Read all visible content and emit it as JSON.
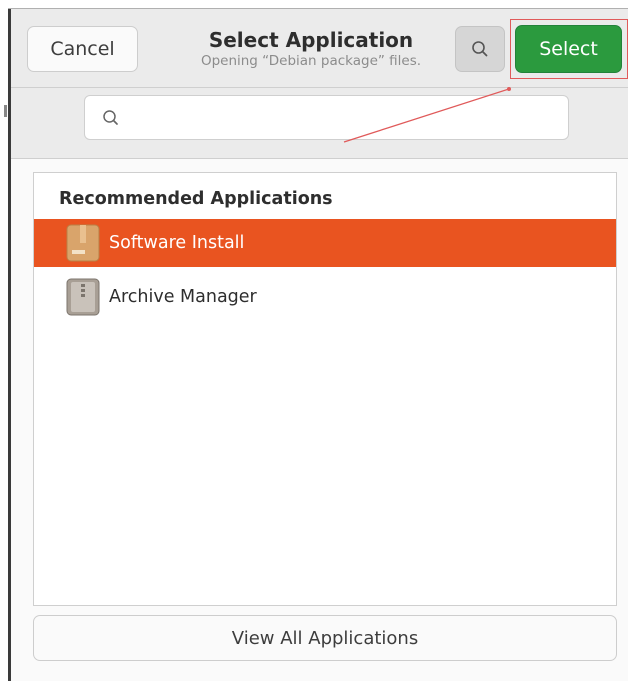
{
  "header": {
    "cancel_label": "Cancel",
    "title": "Select Application",
    "subtitle": "Opening “Debian package” files.",
    "search_icon": "search-icon",
    "select_label": "Select",
    "select_color": "#2b9a3e"
  },
  "search": {
    "placeholder": "",
    "value": "",
    "icon": "search-icon"
  },
  "list": {
    "section_title": "Recommended Applications",
    "items": [
      {
        "label": "Software Install",
        "icon": "software-install-icon",
        "selected": true
      },
      {
        "label": "Archive Manager",
        "icon": "archive-manager-icon",
        "selected": false
      }
    ],
    "selection_color": "#e95420"
  },
  "footer": {
    "view_all_label": "View All Applications"
  }
}
